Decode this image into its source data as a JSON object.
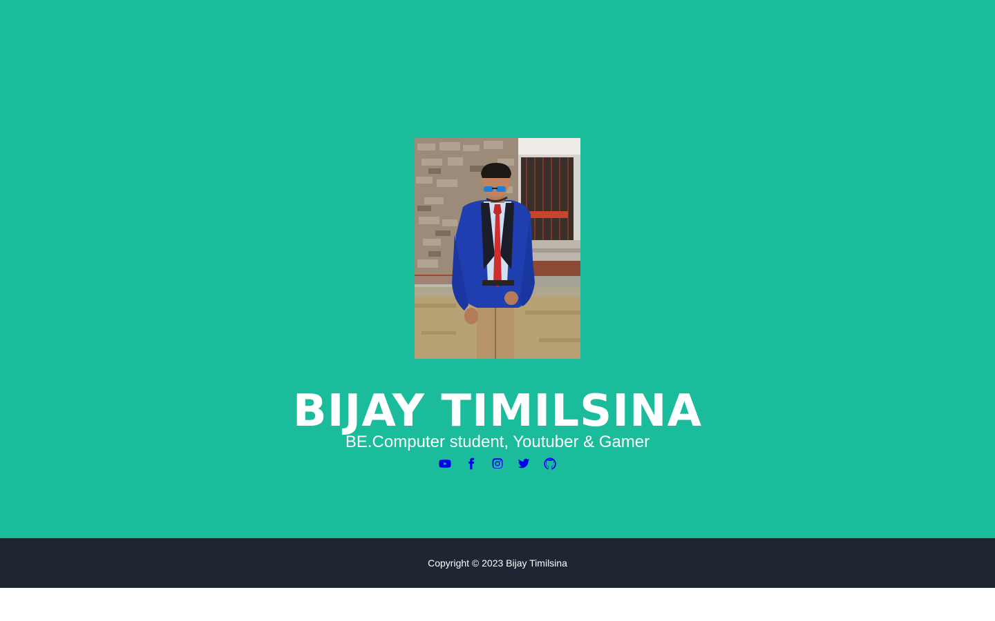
{
  "colors": {
    "hero_background": "#1abc9c",
    "footer_background": "#1e2631",
    "icon_color": "#0000ee",
    "text_color": "#ffffff"
  },
  "profile": {
    "name": "BIJAY TIMILSINA",
    "tagline": "BE.Computer student, Youtuber & Gamer",
    "photo_alt": "Bijay Timilsina"
  },
  "social_links": [
    {
      "icon": "youtube-icon"
    },
    {
      "icon": "facebook-icon"
    },
    {
      "icon": "instagram-icon"
    },
    {
      "icon": "twitter-icon"
    },
    {
      "icon": "github-icon"
    }
  ],
  "footer": {
    "copyright": "Copyright © 2023 Bijay Timilsina"
  }
}
